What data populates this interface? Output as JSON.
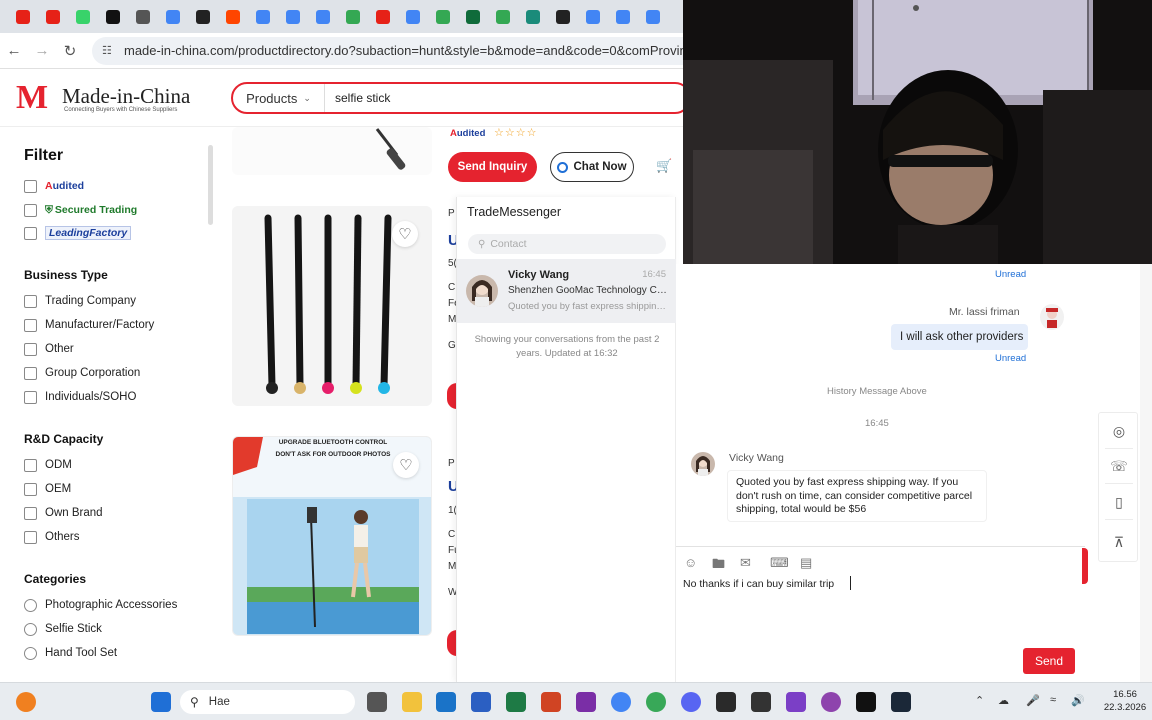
{
  "browser": {
    "tabs": [
      {
        "icon": "youtube-icon",
        "color": "#e62117"
      },
      {
        "icon": "youtube-icon",
        "color": "#e62117"
      },
      {
        "icon": "kick-icon",
        "color": "#38d36a"
      },
      {
        "icon": "tiktok-icon",
        "color": "#111111"
      },
      {
        "icon": "v-icon",
        "color": "#555555"
      },
      {
        "icon": "chrome-icon",
        "color": "#4285f4"
      },
      {
        "icon": "app-icon",
        "color": "#222222"
      },
      {
        "icon": "reddit-icon",
        "color": "#ff4500"
      },
      {
        "icon": "chrome-icon",
        "color": "#4285f4"
      },
      {
        "icon": "chrome-icon",
        "color": "#4285f4"
      },
      {
        "icon": "chrome-icon",
        "color": "#4285f4"
      },
      {
        "icon": "leaf-icon",
        "color": "#34a853"
      },
      {
        "icon": "youtube-icon",
        "color": "#e62117"
      },
      {
        "icon": "chrome-icon",
        "color": "#4285f4"
      },
      {
        "icon": "leaf-icon",
        "color": "#34a853"
      },
      {
        "icon": "circle-icon",
        "color": "#0f6b3a"
      },
      {
        "icon": "leaf-icon",
        "color": "#34a853"
      },
      {
        "icon": "globe-icon",
        "color": "#1a8b7a"
      },
      {
        "icon": "grid-icon",
        "color": "#222222"
      },
      {
        "icon": "chrome-icon",
        "color": "#4285f4"
      },
      {
        "icon": "chrome-icon",
        "color": "#4285f4"
      },
      {
        "icon": "chrome-icon",
        "color": "#4285f4"
      }
    ],
    "url": "made-in-china.com/productdirectory.do?subaction=hunt&style=b&mode=and&code=0&comProvince=nolimit&"
  },
  "site": {
    "logo_text": "Made-in-China",
    "logo_sub": "Connecting Buyers with Chinese Suppliers",
    "search_category": "Products",
    "search_value": "selfie stick"
  },
  "filter": {
    "title": "Filter",
    "badges": {
      "audited_prefix": "A",
      "audited": "udited",
      "secured": "Secured Trading",
      "leading": "LeadingFactory"
    },
    "business_type": {
      "title": "Business Type",
      "items": [
        "Trading Company",
        "Manufacturer/Factory",
        "Other",
        "Group Corporation",
        "Individuals/SOHO"
      ]
    },
    "rd_capacity": {
      "title": "R&D Capacity",
      "items": [
        "ODM",
        "OEM",
        "Own Brand",
        "Others"
      ]
    },
    "categories": {
      "title": "Categories",
      "items": [
        "Photographic Accessories",
        "Selfie Stick",
        "Hand Tool Set"
      ]
    }
  },
  "listing": {
    "audited": "udited",
    "audited_prefix": "A",
    "stars": "☆☆☆☆",
    "send_inquiry": "Send Inquiry",
    "chat_now": "Chat Now",
    "peek": {
      "p1": "P",
      "u1": "U",
      "n1": "5(",
      "c1": "C",
      "f1": "Fe",
      "m1": "M",
      "g1": "G",
      "p2": "P",
      "u2": "U",
      "n2": "1(",
      "c2": "C",
      "f2": "Fu",
      "m2": "M",
      "w2": "W"
    },
    "promo": {
      "line1": "UPGRADE BLUETOOTH CONTROL",
      "line2": "DON'T ASK FOR OUTDOOR PHOTOS"
    }
  },
  "messenger": {
    "title": "TradeMessenger",
    "search_placeholder": "Contact",
    "conversation": {
      "name": "Vicky Wang",
      "time": "16:45",
      "company": "Shenzhen GooMac Technology Co.,...",
      "last": "Quoted you by fast express shipping ..."
    },
    "note": "Showing your conversations from the past 2 years. Updated at 16:32",
    "thread": {
      "unread": "Unread",
      "me_name": "Mr. lassi friman",
      "me_message": "I will ask other providers",
      "history": "History Message Above",
      "time": "16:45",
      "them_name": "Vicky Wang",
      "them_message": "Quoted you by fast express shipping way. If you don't rush on time, can consider competitive parcel shipping, total would be $56"
    },
    "composer_text": "No thanks if i can buy similar trip",
    "send": "Send"
  },
  "taskbar": {
    "search_text": "Hae",
    "clock_time": "16.56",
    "clock_date": "22.3.2026"
  }
}
